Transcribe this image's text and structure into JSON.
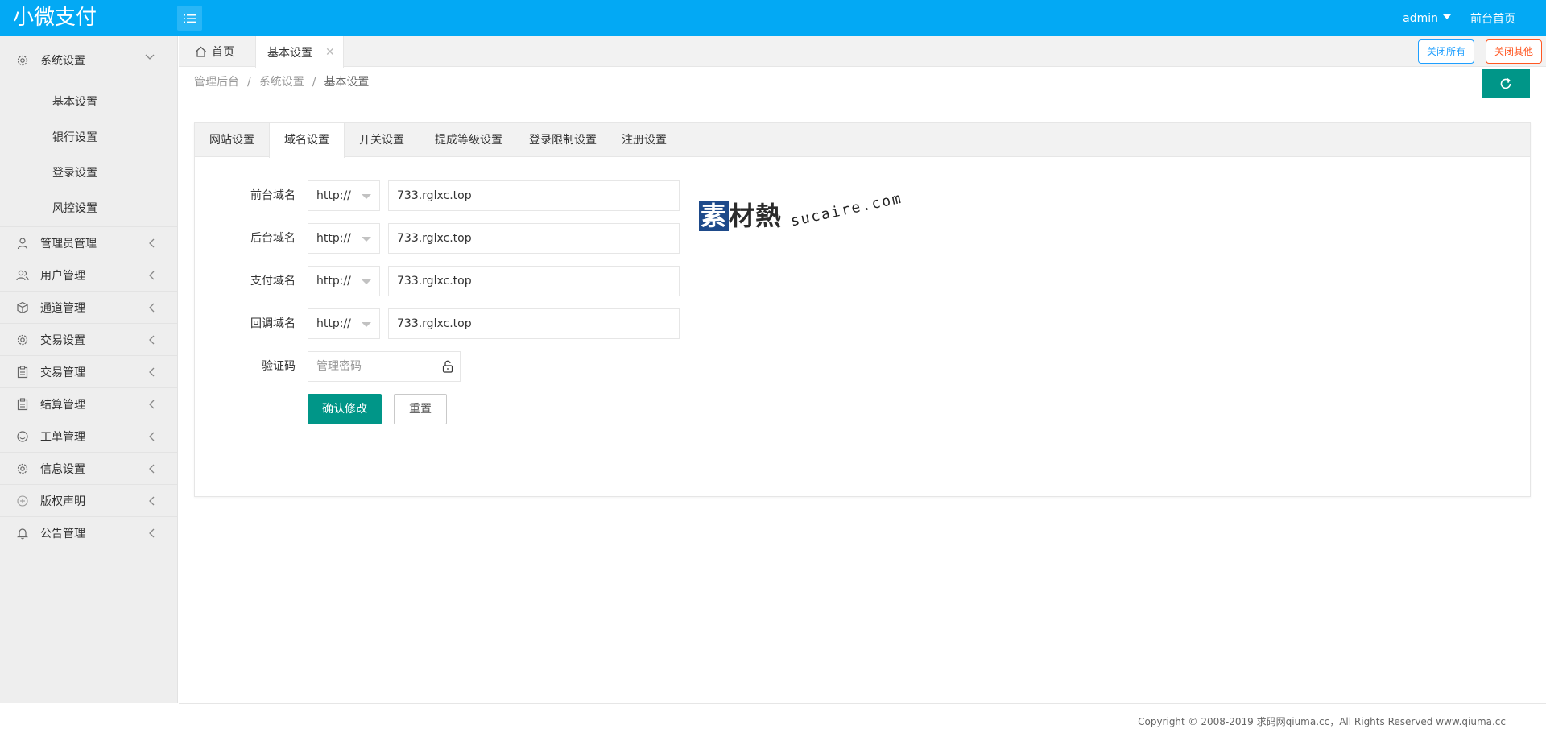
{
  "header": {
    "logo": "小微支付",
    "user": "admin",
    "frontpage_link": "前台首页"
  },
  "sidebar": {
    "items": [
      {
        "label": "系统设置",
        "icon": "gear-icon",
        "expanded": true,
        "children": [
          "基本设置",
          "银行设置",
          "登录设置",
          "风控设置"
        ]
      },
      {
        "label": "管理员管理",
        "icon": "user-icon"
      },
      {
        "label": "用户管理",
        "icon": "users-icon"
      },
      {
        "label": "通道管理",
        "icon": "cube-icon"
      },
      {
        "label": "交易设置",
        "icon": "gear-icon"
      },
      {
        "label": "交易管理",
        "icon": "clipboard-icon"
      },
      {
        "label": "结算管理",
        "icon": "clipboard-icon"
      },
      {
        "label": "工单管理",
        "icon": "smile-icon"
      },
      {
        "label": "信息设置",
        "icon": "gear-icon"
      },
      {
        "label": "版权声明",
        "icon": "plus-circle-icon"
      },
      {
        "label": "公告管理",
        "icon": "bell-icon"
      }
    ]
  },
  "tabs": {
    "home": "首页",
    "active": "基本设置",
    "close_all": "关闭所有",
    "close_other": "关闭其他"
  },
  "breadcrumb": [
    "管理后台",
    "系统设置",
    "基本设置"
  ],
  "card": {
    "tabs": [
      "网站设置",
      "域名设置",
      "开关设置",
      "提成等级设置",
      "登录限制设置",
      "注册设置"
    ],
    "active_tab": 1,
    "rows": [
      {
        "label": "前台域名",
        "protocol": "http://",
        "value": "733.rglxc.top"
      },
      {
        "label": "后台域名",
        "protocol": "http://",
        "value": "733.rglxc.top"
      },
      {
        "label": "支付域名",
        "protocol": "http://",
        "value": "733.rglxc.top"
      },
      {
        "label": "回调域名",
        "protocol": "http://",
        "value": "733.rglxc.top"
      }
    ],
    "captcha_label": "验证码",
    "captcha_placeholder": "管理密码",
    "submit": "确认修改",
    "reset": "重置"
  },
  "watermark": {
    "main": "素材熱",
    "sub": "sucaire.com"
  },
  "footer": "Copyright © 2008-2019 求码网qiuma.cc，All Rights Reserved www.qiuma.cc",
  "colors": {
    "header": "#03a9f4",
    "primary": "#009688",
    "close_all": "#1e9fff",
    "close_other": "#ff5722"
  }
}
